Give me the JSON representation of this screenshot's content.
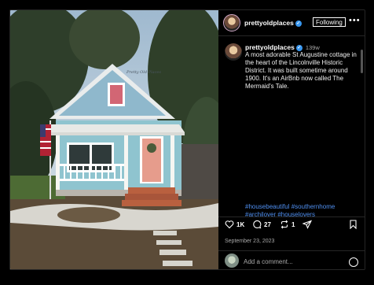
{
  "post": {
    "username": "prettyoldplaces",
    "follow_label": "Following",
    "time_ago": "139w",
    "caption": "A most adorable St Augustine cottage in the heart of the Lincolnville Historic District. It was built sometime around 1900. It's an AirBnb now called The Mermaid's Tale.",
    "hashtags": "#housebeautiful #southernhome #archilover #houselovers",
    "watermark": "Pretty Old Places",
    "date": "September 23, 2023",
    "likes": "1K",
    "comments": "27",
    "shares": "1",
    "comment_placeholder": "Add a comment..."
  },
  "icons": [
    "verified-badge-icon",
    "more-options-icon",
    "heart-icon",
    "comment-icon",
    "repost-icon",
    "share-icon",
    "bookmark-icon",
    "emoji-icon"
  ],
  "colors": {
    "link": "#4f8ff0",
    "verified": "#3897f0",
    "muted": "#a8a8a8"
  }
}
